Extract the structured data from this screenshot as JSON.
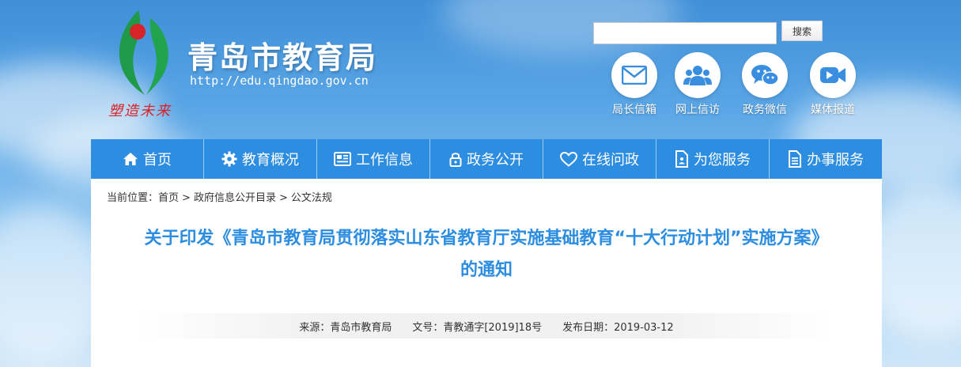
{
  "site": {
    "title": "青岛市教育局",
    "url": "http://edu.qingdao.gov.cn",
    "slogan": "塑造未来"
  },
  "search": {
    "placeholder": "",
    "value": "",
    "button_label": "搜索"
  },
  "quick_links": [
    {
      "label": "局长信箱",
      "icon": "mail-icon"
    },
    {
      "label": "网上信访",
      "icon": "people-icon"
    },
    {
      "label": "政务微信",
      "icon": "wechat-icon"
    },
    {
      "label": "媒体报道",
      "icon": "video-icon"
    }
  ],
  "nav": [
    {
      "label": "首页",
      "icon": "home-icon"
    },
    {
      "label": "教育概况",
      "icon": "gear-icon"
    },
    {
      "label": "工作信息",
      "icon": "newspaper-icon"
    },
    {
      "label": "政务公开",
      "icon": "lock-icon"
    },
    {
      "label": "在线问政",
      "icon": "heart-icon"
    },
    {
      "label": "为您服务",
      "icon": "document-person-icon"
    },
    {
      "label": "办事服务",
      "icon": "document-icon"
    }
  ],
  "breadcrumb": {
    "prefix": "当前位置：",
    "items": [
      "首页",
      "政府信息公开目录",
      "公文法规"
    ],
    "separator": ">"
  },
  "article": {
    "title": "关于印发《青岛市教育局贯彻落实山东省教育厅实施基础教育“十大行动计划”实施方案》的通知",
    "source": "来源：青岛市教育局",
    "doc_number": "文号：青教通字[2019]18号",
    "publish_date": "发布日期：2019-03-12"
  },
  "colors": {
    "nav_bg": "#2d8de0",
    "title": "#2d8de0",
    "slogan": "#d8232a",
    "quick_icon": "#3a8ee0"
  }
}
